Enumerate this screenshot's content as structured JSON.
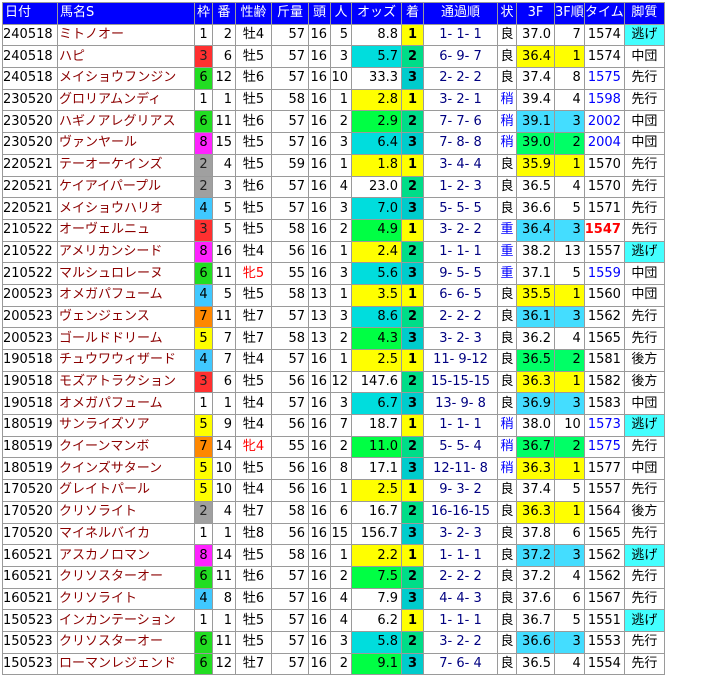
{
  "headers": [
    "日付",
    "馬名S",
    "枠",
    "番",
    "性齢",
    "斤量",
    "頭",
    "人",
    "オッズ",
    "着",
    "通過順",
    "状",
    "3F",
    "3F順",
    "タイム",
    "脚質"
  ],
  "colors": {
    "header_bg": "#0000ff",
    "waku": {
      "1": "#ffffff",
      "2": "#a0a0a0",
      "3": "#ff3030",
      "4": "#40c8ff",
      "5": "#ffff00",
      "6": "#22dd22",
      "7": "#ff8800",
      "8": "#ff22ff"
    },
    "odds_1": "#ffff00",
    "odds_2": "#00ff44",
    "odds_3": "#00dddd",
    "chaku_1": "#ffff00",
    "chaku_2": "#00dd88",
    "chaku_3": "#00cccc",
    "f3_1": "#ffff00",
    "f3_2": "#00ff66",
    "f3_3": "#44ddff",
    "nige": "#44ffff"
  },
  "rows": [
    {
      "date": "240518",
      "name": "ミトノオー",
      "waku": "1",
      "ban": "2",
      "sexage": "牡4",
      "kin": "57",
      "tou": "16",
      "nin": "5",
      "odds": "8.8",
      "chaku": "1",
      "pass": "1- 1- 1",
      "cond": "良",
      "f3": "37.0",
      "f3r": "7",
      "time": "1574",
      "kyaku": "逃げ"
    },
    {
      "date": "240518",
      "name": "ハピ",
      "waku": "3",
      "ban": "6",
      "sexage": "牡5",
      "kin": "57",
      "tou": "16",
      "nin": "3",
      "odds": "5.7",
      "chaku": "2",
      "pass": "6- 9- 7",
      "cond": "良",
      "f3": "36.4",
      "f3r": "1",
      "time": "1574",
      "kyaku": "中団"
    },
    {
      "date": "240518",
      "name": "メイショウフンジン",
      "waku": "6",
      "ban": "12",
      "sexage": "牡6",
      "kin": "57",
      "tou": "16",
      "nin": "10",
      "odds": "33.3",
      "chaku": "3",
      "pass": "2- 2- 2",
      "cond": "良",
      "f3": "37.4",
      "f3r": "8",
      "time": "1575",
      "kyaku": "先行"
    },
    {
      "date": "230520",
      "name": "グロリアムンディ",
      "waku": "1",
      "ban": "1",
      "sexage": "牡5",
      "kin": "58",
      "tou": "16",
      "nin": "1",
      "odds": "2.8",
      "chaku": "1",
      "pass": "3- 2- 1",
      "cond": "稍",
      "f3": "39.4",
      "f3r": "4",
      "time": "1598",
      "kyaku": "先行"
    },
    {
      "date": "230520",
      "name": "ハギノアレグリアス",
      "waku": "6",
      "ban": "11",
      "sexage": "牡6",
      "kin": "57",
      "tou": "16",
      "nin": "2",
      "odds": "2.9",
      "chaku": "2",
      "pass": "7- 7- 6",
      "cond": "稍",
      "f3": "39.1",
      "f3r": "3",
      "time": "2002",
      "kyaku": "中団"
    },
    {
      "date": "230520",
      "name": "ヴァンヤール",
      "waku": "8",
      "ban": "15",
      "sexage": "牡5",
      "kin": "57",
      "tou": "16",
      "nin": "3",
      "odds": "6.4",
      "chaku": "3",
      "pass": "7- 8- 8",
      "cond": "稍",
      "f3": "39.0",
      "f3r": "2",
      "time": "2004",
      "kyaku": "中団"
    },
    {
      "date": "220521",
      "name": "テーオーケインズ",
      "waku": "2",
      "ban": "4",
      "sexage": "牡5",
      "kin": "59",
      "tou": "16",
      "nin": "1",
      "odds": "1.8",
      "chaku": "1",
      "pass": "3- 4- 4",
      "cond": "良",
      "f3": "35.9",
      "f3r": "1",
      "time": "1570",
      "kyaku": "先行"
    },
    {
      "date": "220521",
      "name": "ケイアイパープル",
      "waku": "2",
      "ban": "3",
      "sexage": "牡6",
      "kin": "57",
      "tou": "16",
      "nin": "4",
      "odds": "23.0",
      "chaku": "2",
      "pass": "1- 2- 3",
      "cond": "良",
      "f3": "36.5",
      "f3r": "4",
      "time": "1570",
      "kyaku": "先行"
    },
    {
      "date": "220521",
      "name": "メイショウハリオ",
      "waku": "4",
      "ban": "5",
      "sexage": "牡5",
      "kin": "57",
      "tou": "16",
      "nin": "3",
      "odds": "7.0",
      "chaku": "3",
      "pass": "5- 5- 5",
      "cond": "良",
      "f3": "36.6",
      "f3r": "5",
      "time": "1571",
      "kyaku": "先行"
    },
    {
      "date": "210522",
      "name": "オーヴェルニュ",
      "waku": "3",
      "ban": "5",
      "sexage": "牡5",
      "kin": "58",
      "tou": "16",
      "nin": "2",
      "odds": "4.9",
      "chaku": "1",
      "pass": "3- 2- 2",
      "cond": "重",
      "f3": "36.4",
      "f3r": "3",
      "time": "1547",
      "kyaku": "先行"
    },
    {
      "date": "210522",
      "name": "アメリカンシード",
      "waku": "8",
      "ban": "16",
      "sexage": "牡4",
      "kin": "56",
      "tou": "16",
      "nin": "1",
      "odds": "2.4",
      "chaku": "2",
      "pass": "1- 1- 1",
      "cond": "重",
      "f3": "38.2",
      "f3r": "13",
      "time": "1557",
      "kyaku": "逃げ"
    },
    {
      "date": "210522",
      "name": "マルシュロレーヌ",
      "waku": "6",
      "ban": "11",
      "sexage": "牝5",
      "kin": "55",
      "tou": "16",
      "nin": "3",
      "odds": "5.6",
      "chaku": "3",
      "pass": "9- 5- 5",
      "cond": "重",
      "f3": "37.1",
      "f3r": "5",
      "time": "1559",
      "kyaku": "中団"
    },
    {
      "date": "200523",
      "name": "オメガパフューム",
      "waku": "4",
      "ban": "5",
      "sexage": "牡5",
      "kin": "58",
      "tou": "13",
      "nin": "1",
      "odds": "3.5",
      "chaku": "1",
      "pass": "6- 6- 5",
      "cond": "良",
      "f3": "35.5",
      "f3r": "1",
      "time": "1560",
      "kyaku": "中団"
    },
    {
      "date": "200523",
      "name": "ヴェンジェンス",
      "waku": "7",
      "ban": "11",
      "sexage": "牡7",
      "kin": "57",
      "tou": "13",
      "nin": "3",
      "odds": "8.6",
      "chaku": "2",
      "pass": "2- 2- 2",
      "cond": "良",
      "f3": "36.1",
      "f3r": "3",
      "time": "1562",
      "kyaku": "先行"
    },
    {
      "date": "200523",
      "name": "ゴールドドリーム",
      "waku": "5",
      "ban": "7",
      "sexage": "牡7",
      "kin": "58",
      "tou": "13",
      "nin": "2",
      "odds": "4.3",
      "chaku": "3",
      "pass": "3- 2- 3",
      "cond": "良",
      "f3": "36.2",
      "f3r": "4",
      "time": "1565",
      "kyaku": "先行"
    },
    {
      "date": "190518",
      "name": "チュウワウィザード",
      "waku": "4",
      "ban": "7",
      "sexage": "牡4",
      "kin": "57",
      "tou": "16",
      "nin": "1",
      "odds": "2.5",
      "chaku": "1",
      "pass": "11- 9-12",
      "cond": "良",
      "f3": "36.5",
      "f3r": "2",
      "time": "1581",
      "kyaku": "後方"
    },
    {
      "date": "190518",
      "name": "モズアトラクション",
      "waku": "3",
      "ban": "6",
      "sexage": "牡5",
      "kin": "56",
      "tou": "16",
      "nin": "12",
      "odds": "147.6",
      "chaku": "2",
      "pass": "15-15-15",
      "cond": "良",
      "f3": "36.3",
      "f3r": "1",
      "time": "1582",
      "kyaku": "後方"
    },
    {
      "date": "190518",
      "name": "オメガパフューム",
      "waku": "1",
      "ban": "1",
      "sexage": "牡4",
      "kin": "57",
      "tou": "16",
      "nin": "3",
      "odds": "6.7",
      "chaku": "3",
      "pass": "13- 9- 8",
      "cond": "良",
      "f3": "36.9",
      "f3r": "3",
      "time": "1583",
      "kyaku": "中団"
    },
    {
      "date": "180519",
      "name": "サンライズソア",
      "waku": "5",
      "ban": "9",
      "sexage": "牡4",
      "kin": "56",
      "tou": "16",
      "nin": "7",
      "odds": "18.7",
      "chaku": "1",
      "pass": "1- 1- 1",
      "cond": "稍",
      "f3": "38.0",
      "f3r": "10",
      "time": "1573",
      "kyaku": "逃げ"
    },
    {
      "date": "180519",
      "name": "クイーンマンボ",
      "waku": "7",
      "ban": "14",
      "sexage": "牝4",
      "kin": "55",
      "tou": "16",
      "nin": "2",
      "odds": "11.0",
      "chaku": "2",
      "pass": "5- 5- 4",
      "cond": "稍",
      "f3": "36.7",
      "f3r": "2",
      "time": "1575",
      "kyaku": "先行"
    },
    {
      "date": "180519",
      "name": "クインズサターン",
      "waku": "5",
      "ban": "10",
      "sexage": "牡5",
      "kin": "56",
      "tou": "16",
      "nin": "8",
      "odds": "17.1",
      "chaku": "3",
      "pass": "12-11- 8",
      "cond": "稍",
      "f3": "36.3",
      "f3r": "1",
      "time": "1577",
      "kyaku": "中団"
    },
    {
      "date": "170520",
      "name": "グレイトパール",
      "waku": "5",
      "ban": "10",
      "sexage": "牡4",
      "kin": "56",
      "tou": "16",
      "nin": "1",
      "odds": "2.5",
      "chaku": "1",
      "pass": "9- 3- 2",
      "cond": "良",
      "f3": "37.4",
      "f3r": "5",
      "time": "1557",
      "kyaku": "先行"
    },
    {
      "date": "170520",
      "name": "クリソライト",
      "waku": "2",
      "ban": "4",
      "sexage": "牡7",
      "kin": "58",
      "tou": "16",
      "nin": "6",
      "odds": "16.7",
      "chaku": "2",
      "pass": "16-16-15",
      "cond": "良",
      "f3": "36.3",
      "f3r": "1",
      "time": "1564",
      "kyaku": "後方"
    },
    {
      "date": "170520",
      "name": "マイネルバイカ",
      "waku": "1",
      "ban": "1",
      "sexage": "牡8",
      "kin": "56",
      "tou": "16",
      "nin": "15",
      "odds": "156.7",
      "chaku": "3",
      "pass": "3- 2- 3",
      "cond": "良",
      "f3": "37.8",
      "f3r": "6",
      "time": "1565",
      "kyaku": "先行"
    },
    {
      "date": "160521",
      "name": "アスカノロマン",
      "waku": "8",
      "ban": "14",
      "sexage": "牡5",
      "kin": "58",
      "tou": "16",
      "nin": "1",
      "odds": "2.2",
      "chaku": "1",
      "pass": "1- 1- 1",
      "cond": "良",
      "f3": "37.2",
      "f3r": "3",
      "time": "1562",
      "kyaku": "逃げ"
    },
    {
      "date": "160521",
      "name": "クリソスターオー",
      "waku": "6",
      "ban": "11",
      "sexage": "牡6",
      "kin": "57",
      "tou": "16",
      "nin": "2",
      "odds": "7.5",
      "chaku": "2",
      "pass": "2- 2- 2",
      "cond": "良",
      "f3": "37.2",
      "f3r": "4",
      "time": "1562",
      "kyaku": "先行"
    },
    {
      "date": "160521",
      "name": "クリソライト",
      "waku": "4",
      "ban": "8",
      "sexage": "牡6",
      "kin": "57",
      "tou": "16",
      "nin": "4",
      "odds": "7.9",
      "chaku": "3",
      "pass": "4- 4- 3",
      "cond": "良",
      "f3": "37.6",
      "f3r": "6",
      "time": "1567",
      "kyaku": "先行"
    },
    {
      "date": "150523",
      "name": "インカンテーション",
      "waku": "1",
      "ban": "1",
      "sexage": "牡5",
      "kin": "57",
      "tou": "16",
      "nin": "4",
      "odds": "6.2",
      "chaku": "1",
      "pass": "1- 1- 1",
      "cond": "良",
      "f3": "36.7",
      "f3r": "5",
      "time": "1551",
      "kyaku": "逃げ"
    },
    {
      "date": "150523",
      "name": "クリソスターオー",
      "waku": "6",
      "ban": "11",
      "sexage": "牡5",
      "kin": "57",
      "tou": "16",
      "nin": "3",
      "odds": "5.8",
      "chaku": "2",
      "pass": "3- 2- 2",
      "cond": "良",
      "f3": "36.6",
      "f3r": "3",
      "time": "1553",
      "kyaku": "先行"
    },
    {
      "date": "150523",
      "name": "ローマンレジェンド",
      "waku": "6",
      "ban": "12",
      "sexage": "牡7",
      "kin": "57",
      "tou": "16",
      "nin": "2",
      "odds": "9.1",
      "chaku": "3",
      "pass": "7- 6- 4",
      "cond": "良",
      "f3": "36.5",
      "f3r": "4",
      "time": "1554",
      "kyaku": "先行"
    }
  ]
}
